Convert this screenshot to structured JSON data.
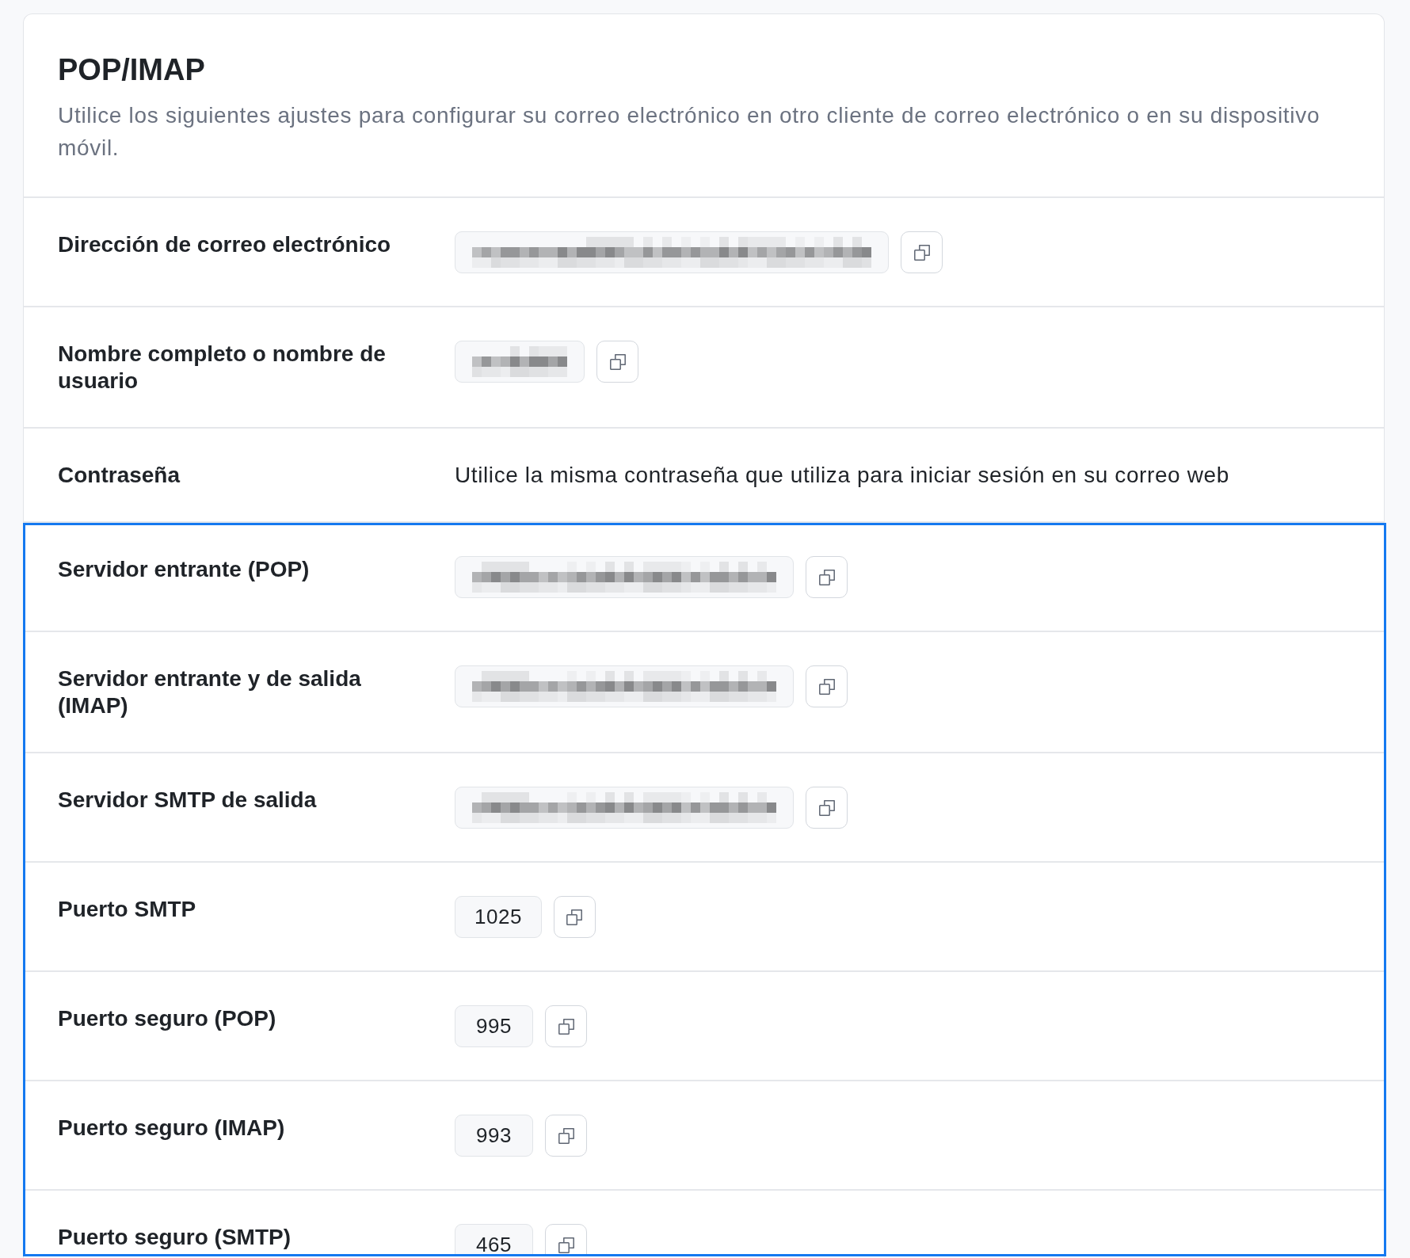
{
  "header": {
    "title": "POP/IMAP",
    "description": "Utilice los siguientes ajustes para configurar su correo electrónico en otro cliente de correo electrónico o en su dispositivo móvil."
  },
  "rows": [
    {
      "label": "Dirección de correo electrónico",
      "kind": "email"
    },
    {
      "label": "Nombre completo o nombre de usuario",
      "kind": "name"
    },
    {
      "label": "Contraseña",
      "kind": "text",
      "value": "Utilice la misma contraseña que utiliza para iniciar sesión en su correo web"
    }
  ],
  "server_section": {
    "highlighted": true,
    "rows": [
      {
        "label": "Servidor entrante (POP)",
        "kind": "host"
      },
      {
        "label": "Servidor entrante y de salida (IMAP)",
        "kind": "host"
      },
      {
        "label": "Servidor SMTP de salida",
        "kind": "host"
      },
      {
        "label": "Puerto SMTP",
        "kind": "port",
        "value": "1025"
      },
      {
        "label": "Puerto seguro (POP)",
        "kind": "port",
        "value": "995"
      },
      {
        "label": "Puerto seguro (IMAP)",
        "kind": "port",
        "value": "993"
      },
      {
        "label": "Puerto seguro (SMTP)",
        "kind": "port",
        "value": "465"
      }
    ]
  }
}
